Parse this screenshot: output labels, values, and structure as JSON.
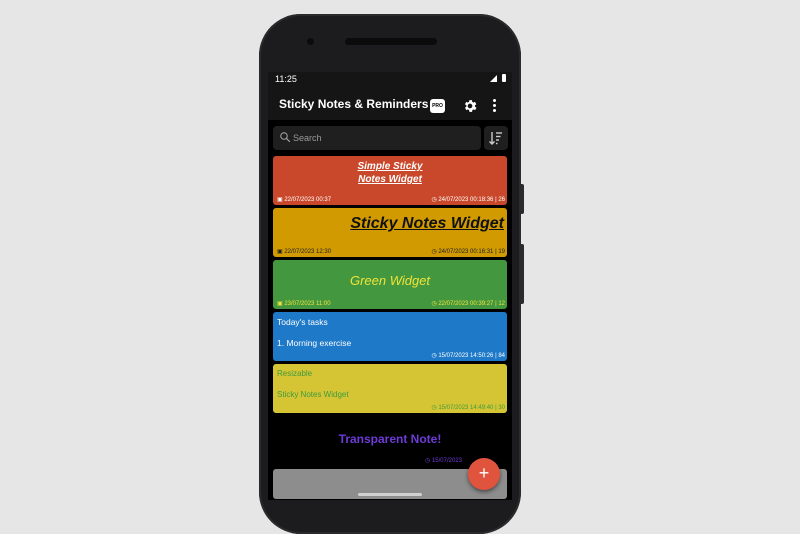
{
  "status_bar": {
    "time": "11:25"
  },
  "app_bar": {
    "title": "Sticky Notes & Reminders",
    "pro_badge": "PRO",
    "icons": [
      "pro-badge-icon",
      "gear-icon",
      "more-vert-icon"
    ]
  },
  "search": {
    "placeholder": "Search",
    "value": "",
    "sort_icon": "sort-icon"
  },
  "notes": [
    {
      "title_line1": "Simple Sticky",
      "title_line2": "Notes Widget",
      "created": "22/07/2023 00:37",
      "updated": "24/07/2023 00:18:36",
      "count": "26",
      "color": "#c9482b"
    },
    {
      "title": "Sticky Notes Widget",
      "created": "22/07/2023 12:30",
      "updated": "24/07/2023 00:16:31",
      "count": "19",
      "color": "#d09a00"
    },
    {
      "title": "Green Widget",
      "created": "23/07/2023 11:00",
      "updated": "22/07/2023 00:39:27",
      "count": "12",
      "color": "#43983f"
    },
    {
      "line1": "Today's tasks",
      "line2": "1. Morning exercise",
      "updated": "15/07/2023 14:50:26",
      "count": "84",
      "color": "#1e79c8"
    },
    {
      "line1": "Resizable",
      "line2": "Sticky Notes Widget",
      "updated": "15/07/2023 14:49:40",
      "count": "30",
      "color": "#d5c535"
    },
    {
      "title": "Transparent Note!",
      "updated": "15/07/2023",
      "color": "#6d3bd6"
    }
  ],
  "fab": {
    "label": "+"
  }
}
